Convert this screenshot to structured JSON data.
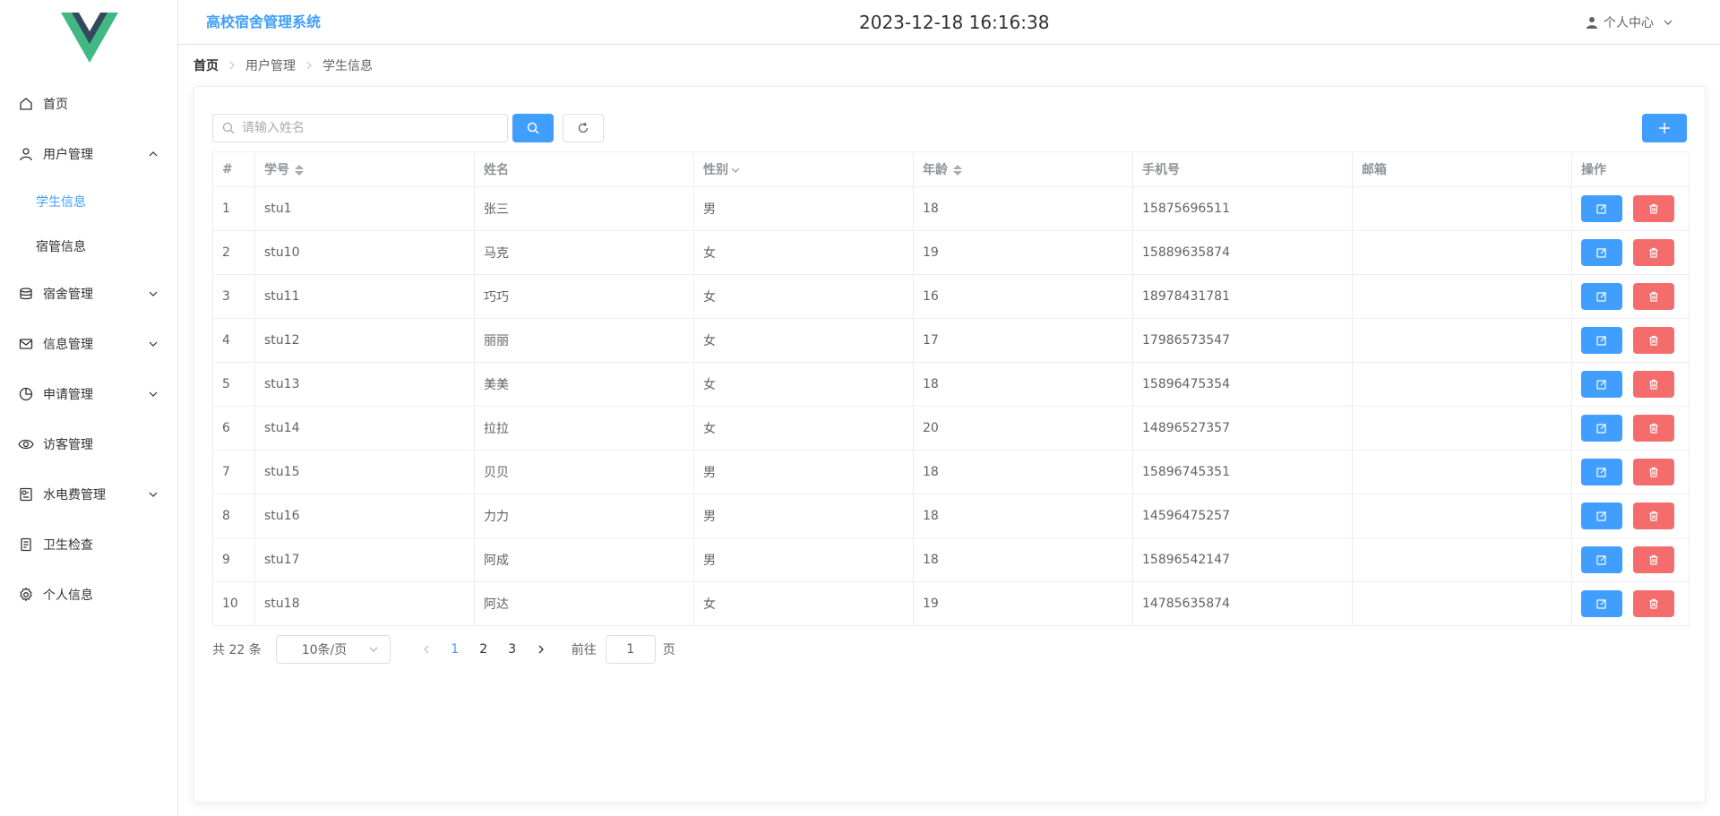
{
  "header": {
    "system_title": "高校宿舍管理系统",
    "clock": "2023-12-18 16:16:38",
    "user_center": "个人中心"
  },
  "sidebar": {
    "items": [
      {
        "label": "首页",
        "icon": "home-icon"
      },
      {
        "label": "用户管理",
        "icon": "user-icon",
        "expanded": true,
        "children": [
          {
            "label": "学生信息",
            "active": true
          },
          {
            "label": "宿管信息"
          }
        ]
      },
      {
        "label": "宿舍管理",
        "icon": "database-icon"
      },
      {
        "label": "信息管理",
        "icon": "message-icon"
      },
      {
        "label": "申请管理",
        "icon": "pie-chart-icon"
      },
      {
        "label": "访客管理",
        "icon": "eye-icon"
      },
      {
        "label": "水电费管理",
        "icon": "water-electric-icon"
      },
      {
        "label": "卫生检查",
        "icon": "document-icon"
      },
      {
        "label": "个人信息",
        "icon": "settings-icon"
      }
    ]
  },
  "breadcrumb": [
    "首页",
    "用户管理",
    "学生信息"
  ],
  "search": {
    "placeholder": "请输入姓名",
    "value": ""
  },
  "table": {
    "columns": [
      "#",
      "学号",
      "姓名",
      "性别",
      "年龄",
      "手机号",
      "邮箱",
      "操作"
    ],
    "rows": [
      {
        "index": "1",
        "id": "stu1",
        "name": "张三",
        "gender": "男",
        "age": "18",
        "phone": "15875696511",
        "email": ""
      },
      {
        "index": "2",
        "id": "stu10",
        "name": "马克",
        "gender": "女",
        "age": "19",
        "phone": "15889635874",
        "email": ""
      },
      {
        "index": "3",
        "id": "stu11",
        "name": "巧巧",
        "gender": "女",
        "age": "16",
        "phone": "18978431781",
        "email": ""
      },
      {
        "index": "4",
        "id": "stu12",
        "name": "丽丽",
        "gender": "女",
        "age": "17",
        "phone": "17986573547",
        "email": ""
      },
      {
        "index": "5",
        "id": "stu13",
        "name": "美美",
        "gender": "女",
        "age": "18",
        "phone": "15896475354",
        "email": ""
      },
      {
        "index": "6",
        "id": "stu14",
        "name": "拉拉",
        "gender": "女",
        "age": "20",
        "phone": "14896527357",
        "email": ""
      },
      {
        "index": "7",
        "id": "stu15",
        "name": "贝贝",
        "gender": "男",
        "age": "18",
        "phone": "15896745351",
        "email": ""
      },
      {
        "index": "8",
        "id": "stu16",
        "name": "力力",
        "gender": "男",
        "age": "18",
        "phone": "14596475257",
        "email": ""
      },
      {
        "index": "9",
        "id": "stu17",
        "name": "阿成",
        "gender": "男",
        "age": "18",
        "phone": "15896542147",
        "email": ""
      },
      {
        "index": "10",
        "id": "stu18",
        "name": "阿达",
        "gender": "女",
        "age": "19",
        "phone": "14785635874",
        "email": ""
      }
    ]
  },
  "pagination": {
    "total_text": "共 22 条",
    "page_size": "10条/页",
    "pages": [
      "1",
      "2",
      "3"
    ],
    "current_page": "1",
    "goto_label": "前往",
    "goto_value": "1",
    "page_suffix": "页"
  },
  "colors": {
    "primary": "#409eff",
    "danger": "#f56c6c",
    "logo_green": "#41b883",
    "logo_dark": "#35495e"
  }
}
